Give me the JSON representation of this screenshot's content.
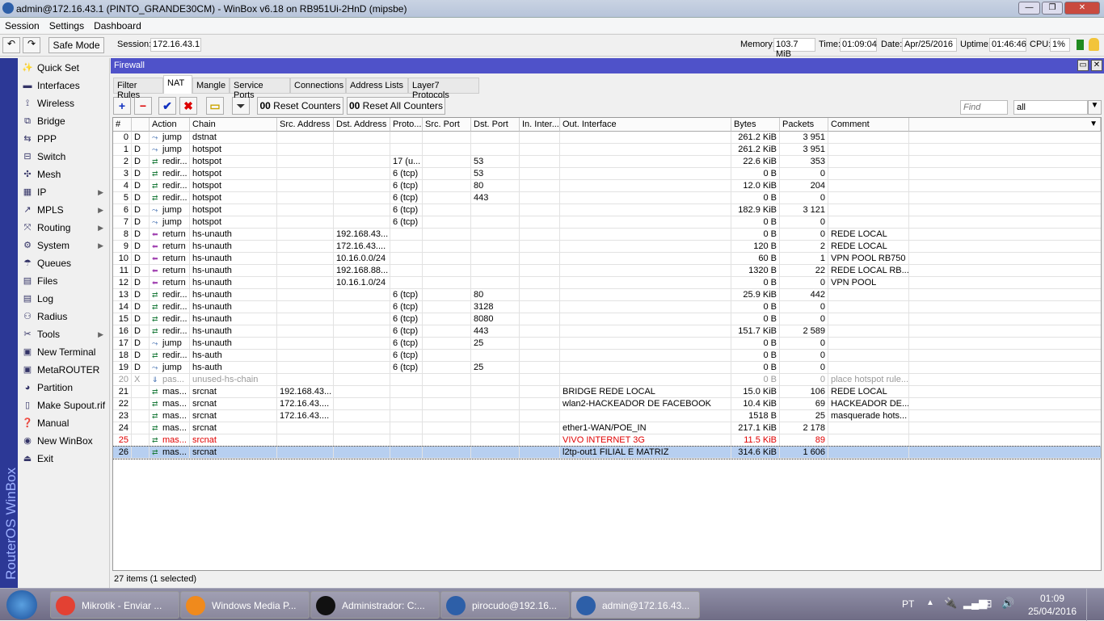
{
  "window": {
    "title": "admin@172.16.43.1 (PINTO_GRANDE30CM) - WinBox v6.18 on RB951Ui-2HnD (mipsbe)"
  },
  "menu": [
    "Session",
    "Settings",
    "Dashboard"
  ],
  "toolbar": {
    "safe_mode": "Safe Mode",
    "session_label": "Session:",
    "session": "172.16.43.1",
    "memory_label": "Memory:",
    "memory": "103.7 MiB",
    "time_label": "Time:",
    "time": "01:09:04",
    "date_label": "Date:",
    "date": "Apr/25/2016",
    "uptime_label": "Uptime:",
    "uptime": "01:46:46",
    "cpu_label": "CPU:",
    "cpu": "1%"
  },
  "brand": "RouterOS WinBox",
  "sidebar": [
    {
      "label": "Quick Set",
      "icon": "wand"
    },
    {
      "label": "Interfaces",
      "icon": "nic"
    },
    {
      "label": "Wireless",
      "icon": "antenna"
    },
    {
      "label": "Bridge",
      "icon": "bridge"
    },
    {
      "label": "PPP",
      "icon": "ppp"
    },
    {
      "label": "Switch",
      "icon": "switch"
    },
    {
      "label": "Mesh",
      "icon": "mesh"
    },
    {
      "label": "IP",
      "icon": "ip",
      "sub": true
    },
    {
      "label": "MPLS",
      "icon": "mpls",
      "sub": true
    },
    {
      "label": "Routing",
      "icon": "routing",
      "sub": true
    },
    {
      "label": "System",
      "icon": "gear",
      "sub": true
    },
    {
      "label": "Queues",
      "icon": "queues"
    },
    {
      "label": "Files",
      "icon": "folder"
    },
    {
      "label": "Log",
      "icon": "log"
    },
    {
      "label": "Radius",
      "icon": "radius"
    },
    {
      "label": "Tools",
      "icon": "tools",
      "sub": true
    },
    {
      "label": "New Terminal",
      "icon": "terminal"
    },
    {
      "label": "MetaROUTER",
      "icon": "metarouter"
    },
    {
      "label": "Partition",
      "icon": "partition"
    },
    {
      "label": "Make Supout.rif",
      "icon": "supout"
    },
    {
      "label": "Manual",
      "icon": "manual"
    },
    {
      "label": "New WinBox",
      "icon": "winbox"
    },
    {
      "label": "Exit",
      "icon": "exit"
    }
  ],
  "firewall": {
    "title": "Firewall",
    "tabs": [
      "Filter Rules",
      "NAT",
      "Mangle",
      "Service Ports",
      "Connections",
      "Address Lists",
      "Layer7 Protocols"
    ],
    "active_tab": "NAT",
    "reset_counters": "Reset Counters",
    "reset_all_counters": "Reset All Counters",
    "counter_prefix": "00",
    "find_placeholder": "Find",
    "filter_value": "all",
    "columns": [
      "#",
      "",
      "Action",
      "Chain",
      "Src. Address",
      "Dst. Address",
      "Proto...",
      "Src. Port",
      "Dst. Port",
      "In. Inter...",
      "Out. Interface",
      "Bytes",
      "Packets",
      "Comment"
    ],
    "rows": [
      [
        "0",
        "D",
        "jump",
        "dstnat",
        "",
        "",
        "",
        "",
        "",
        "",
        "",
        "261.2 KiB",
        "3 951",
        ""
      ],
      [
        "1",
        "D",
        "jump",
        "hotspot",
        "",
        "",
        "",
        "",
        "",
        "",
        "",
        "261.2 KiB",
        "3 951",
        ""
      ],
      [
        "2",
        "D",
        "redir...",
        "hotspot",
        "",
        "",
        "17 (u...",
        "",
        "53",
        "",
        "",
        "22.6 KiB",
        "353",
        ""
      ],
      [
        "3",
        "D",
        "redir...",
        "hotspot",
        "",
        "",
        "6 (tcp)",
        "",
        "53",
        "",
        "",
        "0 B",
        "0",
        ""
      ],
      [
        "4",
        "D",
        "redir...",
        "hotspot",
        "",
        "",
        "6 (tcp)",
        "",
        "80",
        "",
        "",
        "12.0 KiB",
        "204",
        ""
      ],
      [
        "5",
        "D",
        "redir...",
        "hotspot",
        "",
        "",
        "6 (tcp)",
        "",
        "443",
        "",
        "",
        "0 B",
        "0",
        ""
      ],
      [
        "6",
        "D",
        "jump",
        "hotspot",
        "",
        "",
        "6 (tcp)",
        "",
        "",
        "",
        "",
        "182.9 KiB",
        "3 121",
        ""
      ],
      [
        "7",
        "D",
        "jump",
        "hotspot",
        "",
        "",
        "6 (tcp)",
        "",
        "",
        "",
        "",
        "0 B",
        "0",
        ""
      ],
      [
        "8",
        "D",
        "return",
        "hs-unauth",
        "",
        "192.168.43...",
        "",
        "",
        "",
        "",
        "",
        "0 B",
        "0",
        "REDE LOCAL"
      ],
      [
        "9",
        "D",
        "return",
        "hs-unauth",
        "",
        "172.16.43....",
        "",
        "",
        "",
        "",
        "",
        "120 B",
        "2",
        "REDE LOCAL"
      ],
      [
        "10",
        "D",
        "return",
        "hs-unauth",
        "",
        "10.16.0.0/24",
        "",
        "",
        "",
        "",
        "",
        "60 B",
        "1",
        "VPN POOL RB750"
      ],
      [
        "11",
        "D",
        "return",
        "hs-unauth",
        "",
        "192.168.88...",
        "",
        "",
        "",
        "",
        "",
        "1320 B",
        "22",
        "REDE LOCAL RB..."
      ],
      [
        "12",
        "D",
        "return",
        "hs-unauth",
        "",
        "10.16.1.0/24",
        "",
        "",
        "",
        "",
        "",
        "0 B",
        "0",
        "VPN POOL"
      ],
      [
        "13",
        "D",
        "redir...",
        "hs-unauth",
        "",
        "",
        "6 (tcp)",
        "",
        "80",
        "",
        "",
        "25.9 KiB",
        "442",
        ""
      ],
      [
        "14",
        "D",
        "redir...",
        "hs-unauth",
        "",
        "",
        "6 (tcp)",
        "",
        "3128",
        "",
        "",
        "0 B",
        "0",
        ""
      ],
      [
        "15",
        "D",
        "redir...",
        "hs-unauth",
        "",
        "",
        "6 (tcp)",
        "",
        "8080",
        "",
        "",
        "0 B",
        "0",
        ""
      ],
      [
        "16",
        "D",
        "redir...",
        "hs-unauth",
        "",
        "",
        "6 (tcp)",
        "",
        "443",
        "",
        "",
        "151.7 KiB",
        "2 589",
        ""
      ],
      [
        "17",
        "D",
        "jump",
        "hs-unauth",
        "",
        "",
        "6 (tcp)",
        "",
        "25",
        "",
        "",
        "0 B",
        "0",
        ""
      ],
      [
        "18",
        "D",
        "redir...",
        "hs-auth",
        "",
        "",
        "6 (tcp)",
        "",
        "",
        "",
        "",
        "0 B",
        "0",
        ""
      ],
      [
        "19",
        "D",
        "jump",
        "hs-auth",
        "",
        "",
        "6 (tcp)",
        "",
        "25",
        "",
        "",
        "0 B",
        "0",
        ""
      ],
      [
        "20",
        "X",
        "pas...",
        "unused-hs-chain",
        "",
        "",
        "",
        "",
        "",
        "",
        "",
        "0 B",
        "0",
        "place hotspot rule..."
      ],
      [
        "21",
        "",
        "mas...",
        "srcnat",
        "192.168.43...",
        "",
        "",
        "",
        "",
        "",
        "BRIDGE REDE LOCAL",
        "15.0 KiB",
        "106",
        "REDE LOCAL"
      ],
      [
        "22",
        "",
        "mas...",
        "srcnat",
        "172.16.43....",
        "",
        "",
        "",
        "",
        "",
        "wlan2-HACKEADOR DE FACEBOOK",
        "10.4 KiB",
        "69",
        "HACKEADOR DE..."
      ],
      [
        "23",
        "",
        "mas...",
        "srcnat",
        "172.16.43....",
        "",
        "",
        "",
        "",
        "",
        "",
        "1518 B",
        "25",
        "masquerade hots..."
      ],
      [
        "24",
        "",
        "mas...",
        "srcnat",
        "",
        "",
        "",
        "",
        "",
        "",
        "ether1-WAN/POE_IN",
        "217.1 KiB",
        "2 178",
        ""
      ],
      [
        "25",
        "",
        "mas...",
        "srcnat",
        "",
        "",
        "",
        "",
        "",
        "",
        "VIVO INTERNET 3G",
        "11.5 KiB",
        "89",
        ""
      ],
      [
        "26",
        "",
        "mas...",
        "srcnat",
        "",
        "",
        "",
        "",
        "",
        "",
        "l2tp-out1 FILIAL E MATRIZ",
        "314.6 KiB",
        "1 606",
        ""
      ]
    ],
    "disabled_rows": [
      20
    ],
    "red_rows": [
      25
    ],
    "selected_rows": [
      26
    ],
    "status": "27 items (1 selected)"
  },
  "taskbar": {
    "items": [
      "Mikrotik - Enviar ...",
      "Windows Media P...",
      "Administrador: C:...",
      "pirocudo@192.16...",
      "admin@172.16.43..."
    ],
    "lang": "PT",
    "clock_time": "01:09",
    "clock_date": "25/04/2016"
  },
  "colors": {
    "firewall_title": "#4f52c9",
    "selected_row": "#b7cff0",
    "error_row": "#e00000"
  }
}
